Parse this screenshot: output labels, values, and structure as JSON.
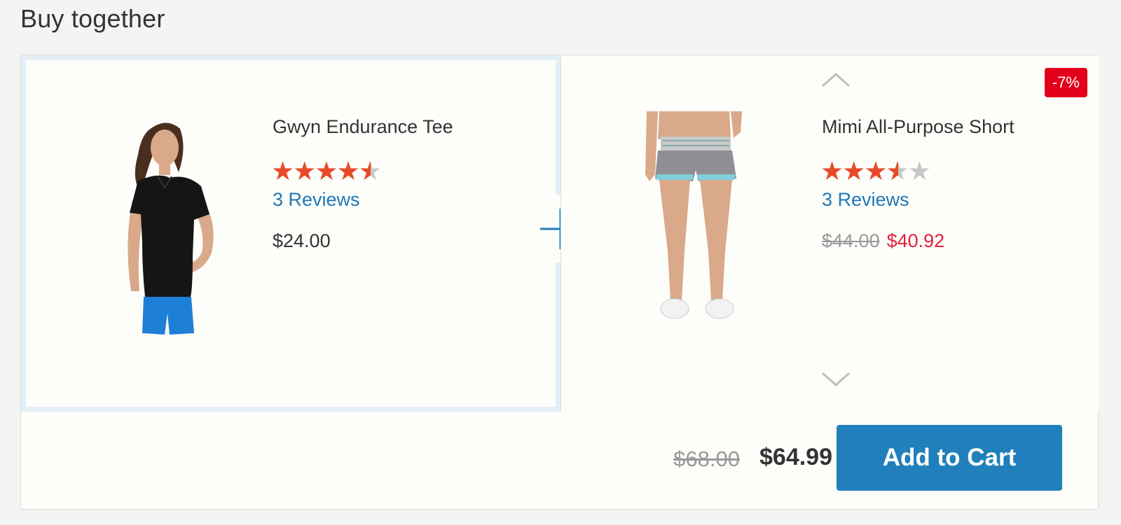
{
  "section": {
    "title": "Buy together"
  },
  "products": [
    {
      "name": "Gwyn Endurance Tee",
      "rating_stars": 4.5,
      "reviews": "3 Reviews",
      "price": "$24.00"
    },
    {
      "name": "Mimi All-Purpose Short",
      "rating_stars": 3.5,
      "reviews": "3 Reviews",
      "old_price": "$44.00",
      "special_price": "$40.92",
      "discount_badge": "-7%"
    }
  ],
  "footer": {
    "old_total": "$68.00",
    "total": "$64.99",
    "add_to_cart": "Add to Cart"
  },
  "colors": {
    "accent": "#2180bb",
    "star": "#e84a27",
    "sale": "#e0213e",
    "badge": "#e3001b",
    "link": "#1f78b4"
  },
  "icons": [
    "plus-icon",
    "chevron-up-icon",
    "chevron-down-icon",
    "star-icon",
    "hand-cursor-icon"
  ]
}
